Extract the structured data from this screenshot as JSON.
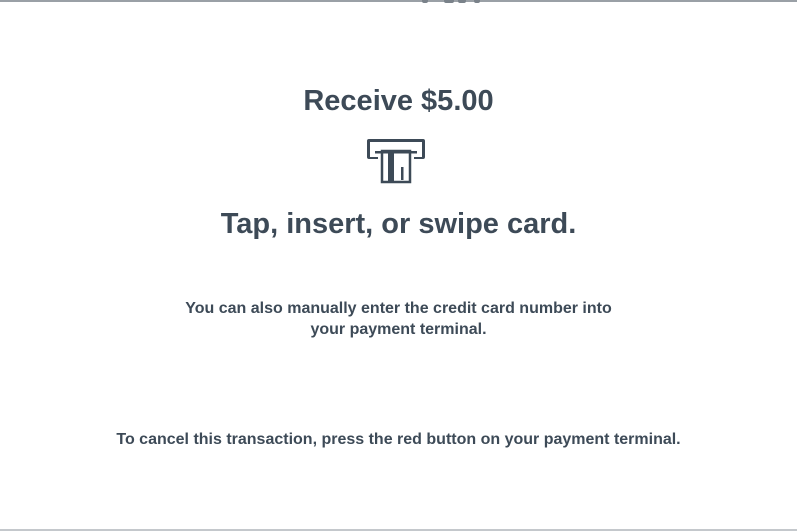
{
  "payment": {
    "title": "Receive $5.00",
    "instruction": "Tap, insert, or swipe card.",
    "manual_entry_note": "You can also manually enter the credit card number into your payment terminal.",
    "cancel_note": "To cancel this transaction, press the red button on your payment terminal.",
    "icon": "card-insert-icon"
  },
  "colors": {
    "text": "#3d4a57",
    "background": "#ffffff"
  }
}
